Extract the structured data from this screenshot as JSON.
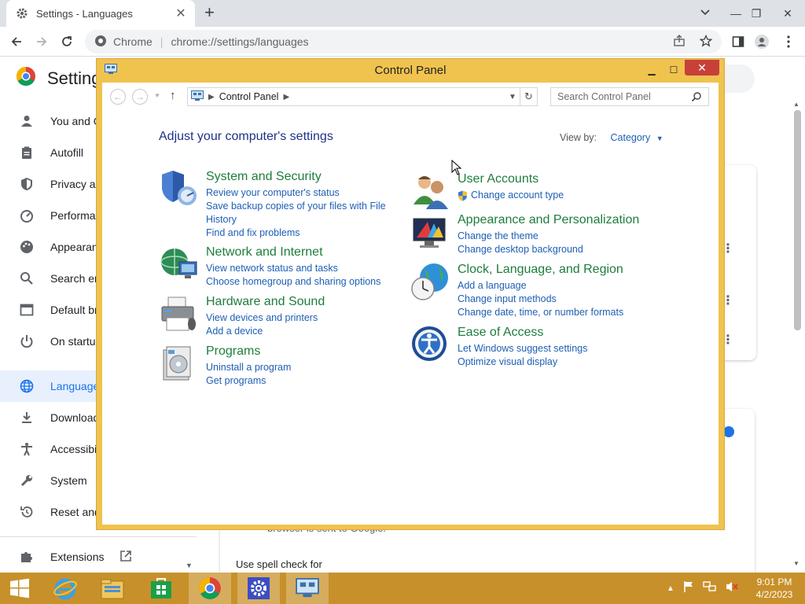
{
  "browser": {
    "tab_title": "Settings - Languages",
    "site_label": "Chrome",
    "url": "chrome://settings/languages"
  },
  "settings": {
    "title": "Settings",
    "nav": [
      {
        "label": "You and Google",
        "icon": "person-icon"
      },
      {
        "label": "Autofill",
        "icon": "clipboard-icon"
      },
      {
        "label": "Privacy and security",
        "icon": "shield-icon"
      },
      {
        "label": "Performance",
        "icon": "speedometer-icon"
      },
      {
        "label": "Appearance",
        "icon": "palette-icon"
      },
      {
        "label": "Search engine",
        "icon": "search-icon"
      },
      {
        "label": "Default browser",
        "icon": "browser-icon"
      },
      {
        "label": "On startup",
        "icon": "power-icon"
      },
      {
        "label": "Languages",
        "icon": "globe-icon",
        "active": true
      },
      {
        "label": "Downloads",
        "icon": "download-icon"
      },
      {
        "label": "Accessibility",
        "icon": "accessibility-icon"
      },
      {
        "label": "System",
        "icon": "wrench-icon"
      },
      {
        "label": "Reset and clean up",
        "icon": "restore-icon"
      }
    ],
    "extensions_label": "Extensions",
    "spell_check_label": "Use spell check for",
    "sent_text": "browser is sent to Google."
  },
  "control_panel": {
    "window_title": "Control Panel",
    "address": "Control Panel",
    "search_placeholder": "Search Control Panel",
    "heading": "Adjust your computer's settings",
    "view_by_label": "View by:",
    "view_by_value": "Category",
    "categories_left": [
      {
        "title": "System and Security",
        "icon": "security-shield-icon",
        "links": [
          "Review your computer's status",
          "Save backup copies of your files with File",
          "History",
          "Find and fix problems"
        ]
      },
      {
        "title": "Network and Internet",
        "icon": "network-globe-icon",
        "links": [
          "View network status and tasks",
          "Choose homegroup and sharing options"
        ]
      },
      {
        "title": "Hardware and Sound",
        "icon": "printer-icon",
        "links": [
          "View devices and printers",
          "Add a device"
        ]
      },
      {
        "title": "Programs",
        "icon": "programs-icon",
        "links": [
          "Uninstall a program",
          "Get programs"
        ]
      }
    ],
    "categories_right": [
      {
        "title": "User Accounts",
        "icon": "users-icon",
        "links": [
          "Change account type"
        ]
      },
      {
        "title": "Appearance and Personalization",
        "icon": "monitor-colors-icon",
        "links": [
          "Change the theme",
          "Change desktop background"
        ]
      },
      {
        "title": "Clock, Language, and Region",
        "icon": "clock-globe-icon",
        "links": [
          "Add a language",
          "Change input methods",
          "Change date, time, or number formats"
        ]
      },
      {
        "title": "Ease of Access",
        "icon": "ease-of-access-icon",
        "links": [
          "Let Windows suggest settings",
          "Optimize visual display"
        ]
      }
    ]
  },
  "taskbar": {
    "time": "9:01 PM",
    "date": "4/2/2023"
  }
}
